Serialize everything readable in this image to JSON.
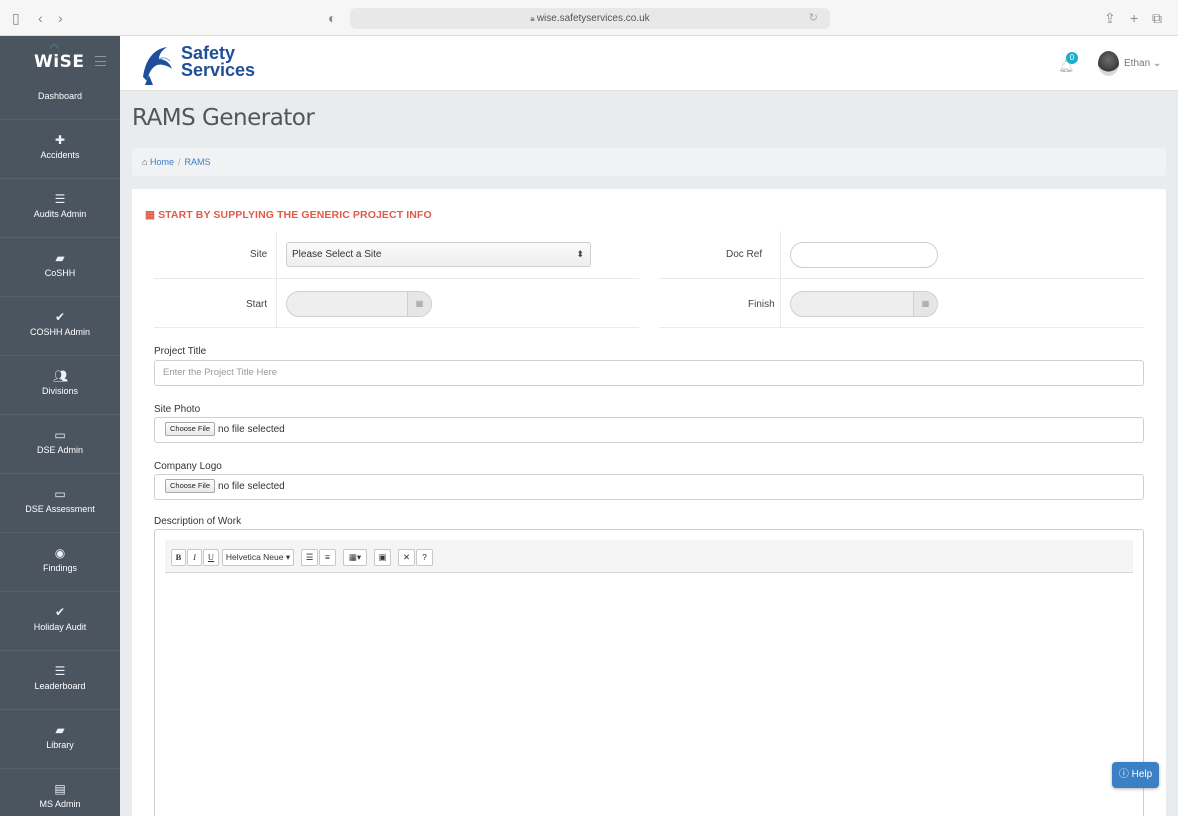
{
  "browser": {
    "url": "wise.safetyservices.co.uk"
  },
  "header": {
    "app_logo": "WiSE",
    "brand_line1": "Safety",
    "brand_line2": "Services",
    "notification_count": "0",
    "user_name": "Ethan"
  },
  "sidebar": {
    "items": [
      {
        "label": "Dashboard",
        "icon": "dashboard-icon"
      },
      {
        "label": "Accidents",
        "icon": "first-aid-icon"
      },
      {
        "label": "Audits Admin",
        "icon": "list-icon"
      },
      {
        "label": "CoSHH",
        "icon": "book-icon"
      },
      {
        "label": "COSHH Admin",
        "icon": "checkmark-icon"
      },
      {
        "label": "Divisions",
        "icon": "users-icon"
      },
      {
        "label": "DSE Admin",
        "icon": "monitor-icon"
      },
      {
        "label": "DSE Assessment",
        "icon": "monitor-icon"
      },
      {
        "label": "Findings",
        "icon": "eye-icon"
      },
      {
        "label": "Holiday Audit",
        "icon": "checkmark-icon"
      },
      {
        "label": "Leaderboard",
        "icon": "list-icon"
      },
      {
        "label": "Library",
        "icon": "book-icon"
      },
      {
        "label": "MS Admin",
        "icon": "calendar-icon"
      }
    ]
  },
  "page": {
    "title": "RAMS Generator",
    "breadcrumb_home": "Home",
    "breadcrumb_current": "RAMS"
  },
  "form": {
    "section_heading": "START BY SUPPLYING THE GENERIC PROJECT INFO",
    "site_label": "Site",
    "site_value": "Please Select a Site",
    "docref_label": "Doc Ref",
    "docref_value": "",
    "start_label": "Start",
    "start_value": "",
    "finish_label": "Finish",
    "finish_value": "",
    "project_title_label": "Project Title",
    "project_title_placeholder": "Enter the Project Title Here",
    "site_photo_label": "Site Photo",
    "company_logo_label": "Company Logo",
    "choose_file_label": "Choose File",
    "no_file_text": "no file selected",
    "description_label": "Description of Work"
  },
  "editor_toolbar": {
    "bold": "B",
    "italic": "I",
    "underline": "U",
    "font_name": "Helvetica Neue"
  },
  "help": {
    "label": "Help"
  },
  "colors": {
    "sidebar_bg": "#4a5560",
    "accent_red": "#e05a4a",
    "accent_blue": "#3b7fc4",
    "badge_teal": "#1ab0c9"
  }
}
